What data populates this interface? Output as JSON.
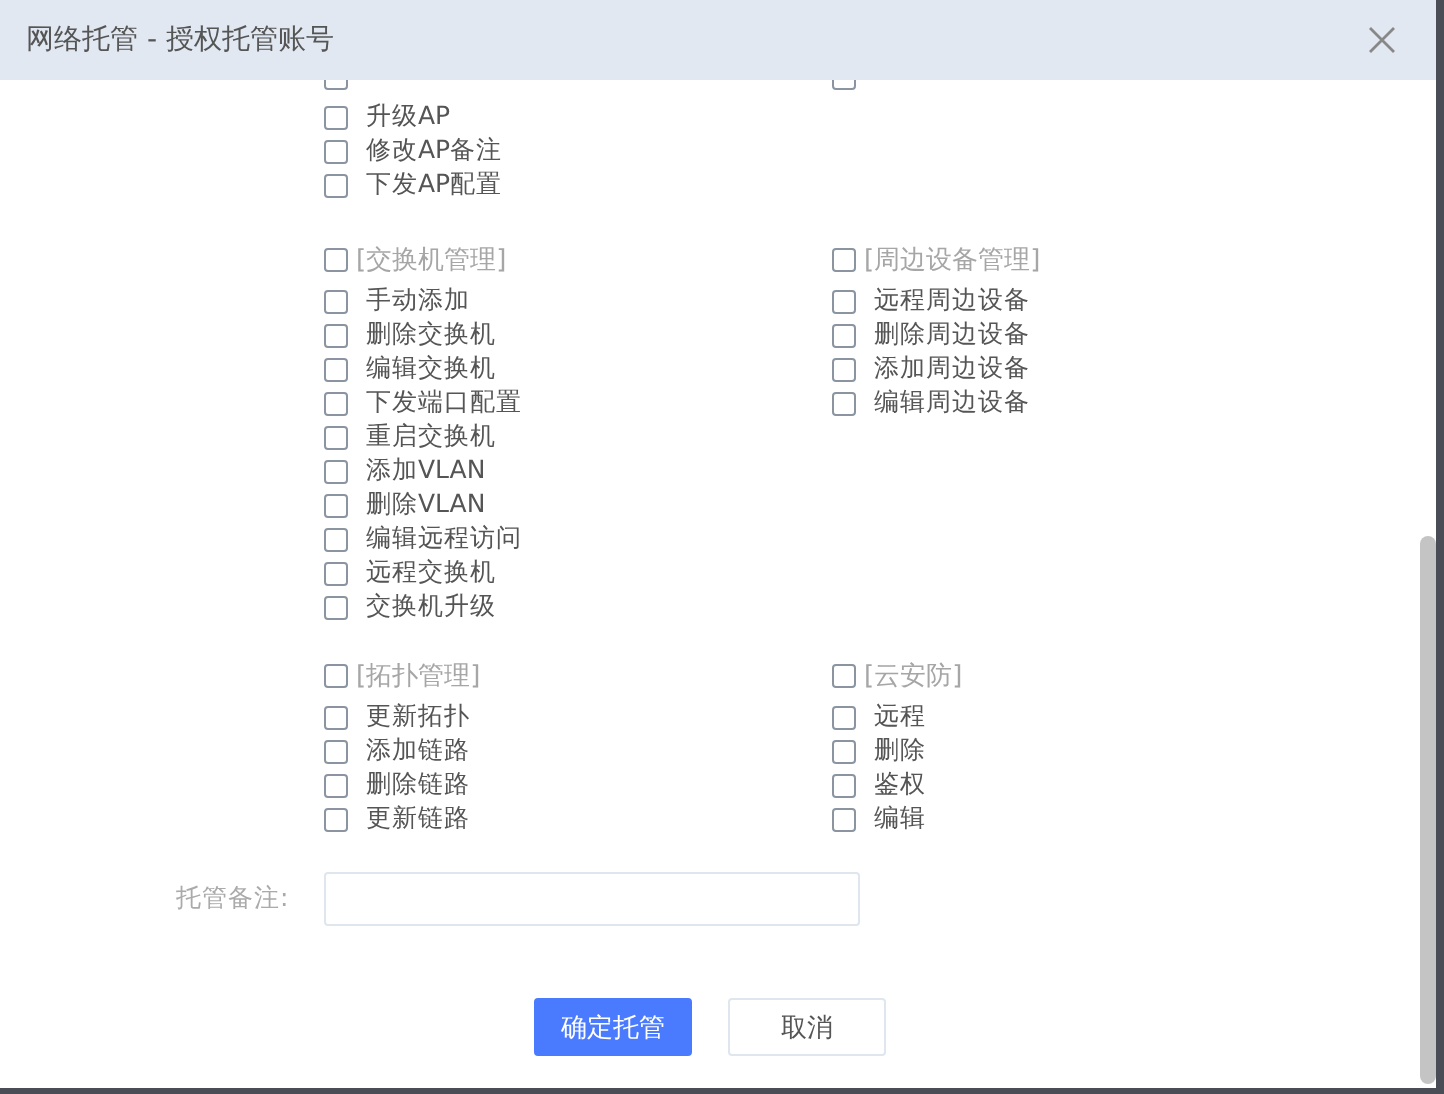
{
  "window": {
    "title": "网络托管 - 授权托管账号"
  },
  "cut_row": [
    {
      "checked": false
    },
    {
      "checked": false
    }
  ],
  "top_items": [
    {
      "label": "升级AP",
      "checked": false
    },
    {
      "label": "修改AP备注",
      "checked": false
    },
    {
      "label": "下发AP配置",
      "checked": false
    }
  ],
  "group_rows": [
    [
      {
        "title": "[交换机管理]",
        "checked": false,
        "items": [
          {
            "label": "手动添加",
            "checked": false
          },
          {
            "label": "删除交换机",
            "checked": false
          },
          {
            "label": "编辑交换机",
            "checked": false
          },
          {
            "label": "下发端口配置",
            "checked": false
          },
          {
            "label": "重启交换机",
            "checked": false
          },
          {
            "label": "添加VLAN",
            "checked": false
          },
          {
            "label": "删除VLAN",
            "checked": false
          },
          {
            "label": "编辑远程访问",
            "checked": false
          },
          {
            "label": "远程交换机",
            "checked": false
          },
          {
            "label": "交换机升级",
            "checked": false
          }
        ]
      },
      {
        "title": "[周边设备管理]",
        "checked": false,
        "items": [
          {
            "label": "远程周边设备",
            "checked": false
          },
          {
            "label": "删除周边设备",
            "checked": false
          },
          {
            "label": "添加周边设备",
            "checked": false
          },
          {
            "label": "编辑周边设备",
            "checked": false
          }
        ]
      }
    ],
    [
      {
        "title": "[拓扑管理]",
        "checked": false,
        "items": [
          {
            "label": "更新拓扑",
            "checked": false
          },
          {
            "label": "添加链路",
            "checked": false
          },
          {
            "label": "删除链路",
            "checked": false
          },
          {
            "label": "更新链路",
            "checked": false
          }
        ]
      },
      {
        "title": "[云安防]",
        "checked": false,
        "items": [
          {
            "label": "远程",
            "checked": false
          },
          {
            "label": "删除",
            "checked": false
          },
          {
            "label": "鉴权",
            "checked": false
          },
          {
            "label": "编辑",
            "checked": false
          }
        ]
      }
    ]
  ],
  "remark": {
    "label": "托管备注:"
  },
  "buttons": [
    {
      "label": "确定托管",
      "kind": "primary"
    },
    {
      "label": "取消",
      "kind": "default"
    }
  ]
}
